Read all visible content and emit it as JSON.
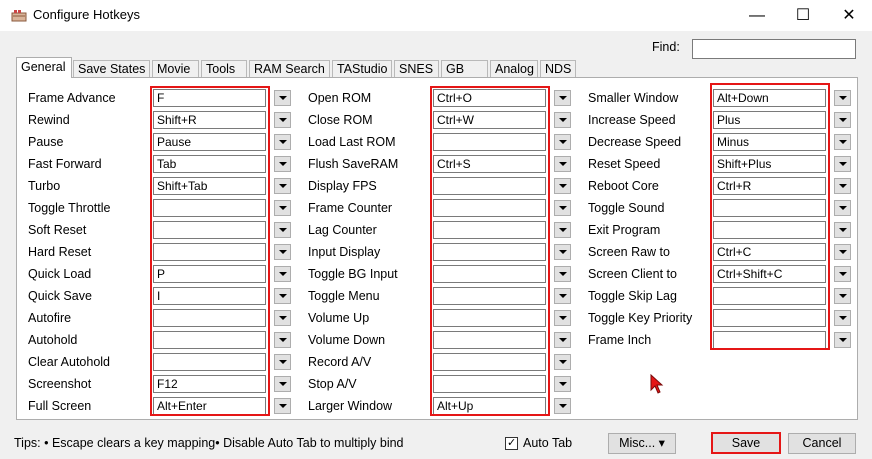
{
  "window": {
    "title": "Configure Hotkeys",
    "icon": "bizhawk-app-icon",
    "minimize_icon": "minimize-icon",
    "maximize_icon": "maximize-icon",
    "close_icon": "close-icon",
    "minimize_glyph": "—",
    "maximize_glyph": "☐",
    "close_glyph": "✕"
  },
  "find": {
    "label": "Find:",
    "value": ""
  },
  "tabs": [
    {
      "label": "General",
      "active": true
    },
    {
      "label": "Save States"
    },
    {
      "label": "Movie"
    },
    {
      "label": "Tools"
    },
    {
      "label": "RAM Search"
    },
    {
      "label": "TAStudio"
    },
    {
      "label": "SNES"
    },
    {
      "label": "GB"
    },
    {
      "label": "Analog"
    },
    {
      "label": "NDS"
    }
  ],
  "columns": [
    {
      "rows": [
        {
          "label": "Frame Advance",
          "value": "F"
        },
        {
          "label": "Rewind",
          "value": "Shift+R"
        },
        {
          "label": "Pause",
          "value": "Pause"
        },
        {
          "label": "Fast Forward",
          "value": "Tab"
        },
        {
          "label": "Turbo",
          "value": "Shift+Tab"
        },
        {
          "label": "Toggle Throttle",
          "value": ""
        },
        {
          "label": "Soft Reset",
          "value": ""
        },
        {
          "label": "Hard Reset",
          "value": ""
        },
        {
          "label": "Quick Load",
          "value": "P"
        },
        {
          "label": "Quick Save",
          "value": "I"
        },
        {
          "label": "Autofire",
          "value": ""
        },
        {
          "label": "Autohold",
          "value": ""
        },
        {
          "label": "Clear Autohold",
          "value": ""
        },
        {
          "label": "Screenshot",
          "value": "F12"
        },
        {
          "label": "Full Screen",
          "value": "Alt+Enter"
        }
      ]
    },
    {
      "rows": [
        {
          "label": "Open ROM",
          "value": "Ctrl+O"
        },
        {
          "label": "Close ROM",
          "value": "Ctrl+W"
        },
        {
          "label": "Load Last ROM",
          "value": ""
        },
        {
          "label": "Flush SaveRAM",
          "value": "Ctrl+S"
        },
        {
          "label": "Display FPS",
          "value": ""
        },
        {
          "label": "Frame Counter",
          "value": ""
        },
        {
          "label": "Lag Counter",
          "value": ""
        },
        {
          "label": "Input Display",
          "value": ""
        },
        {
          "label": "Toggle BG Input",
          "value": ""
        },
        {
          "label": "Toggle Menu",
          "value": ""
        },
        {
          "label": "Volume Up",
          "value": ""
        },
        {
          "label": "Volume Down",
          "value": ""
        },
        {
          "label": "Record A/V",
          "value": ""
        },
        {
          "label": "Stop A/V",
          "value": ""
        },
        {
          "label": "Larger Window",
          "value": "Alt+Up"
        }
      ]
    },
    {
      "rows": [
        {
          "label": "Smaller Window",
          "value": "Alt+Down"
        },
        {
          "label": "Increase Speed",
          "value": "Plus"
        },
        {
          "label": "Decrease Speed",
          "value": "Minus"
        },
        {
          "label": "Reset Speed",
          "value": "Shift+Plus"
        },
        {
          "label": "Reboot Core",
          "value": "Ctrl+R"
        },
        {
          "label": "Toggle Sound",
          "value": ""
        },
        {
          "label": "Exit Program",
          "value": ""
        },
        {
          "label": "Screen Raw to",
          "value": "Ctrl+C"
        },
        {
          "label": "Screen Client to",
          "value": "Ctrl+Shift+C"
        },
        {
          "label": "Toggle Skip Lag",
          "value": ""
        },
        {
          "label": "Toggle Key Priority",
          "value": ""
        },
        {
          "label": "Frame Inch",
          "value": ""
        }
      ]
    }
  ],
  "footer": {
    "tips": "Tips:  • Escape clears a key mapping• Disable Auto Tab to multiply bind",
    "auto_tab_label": "Auto Tab",
    "auto_tab_checked": true,
    "check_glyph": "✓",
    "misc_label": "Misc...",
    "misc_arrow": "▾",
    "save_label": "Save",
    "cancel_label": "Cancel"
  },
  "colors": {
    "highlight": "#e51616",
    "panel_bg": "#ffffff",
    "window_bg": "#f0f0f0"
  }
}
